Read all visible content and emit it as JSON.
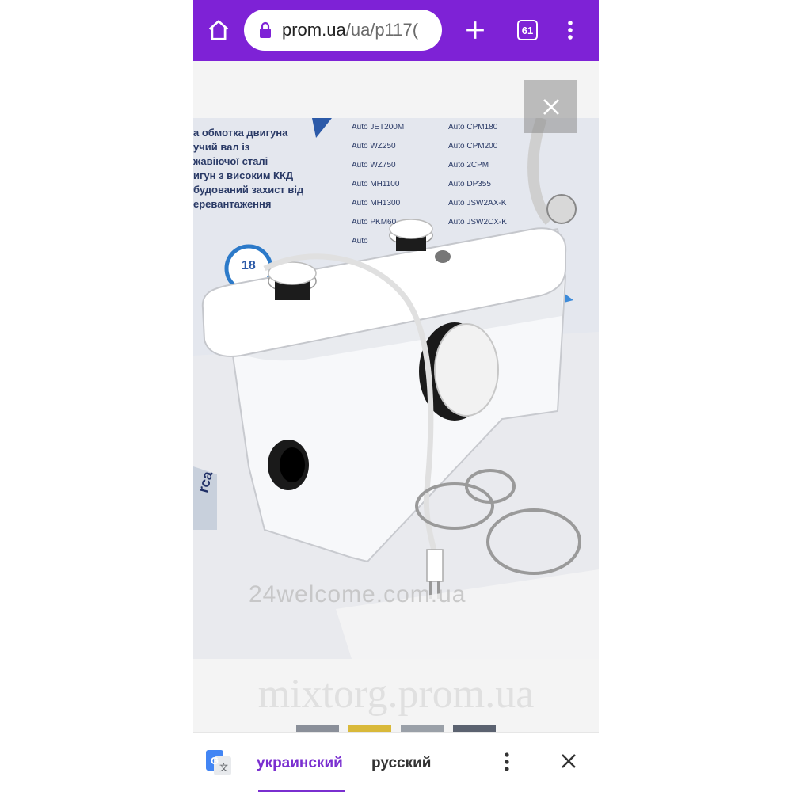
{
  "browser": {
    "url_host": "prom.ua",
    "url_path": "/ua/p117(",
    "tab_count": "61",
    "accent_color": "#7e22d6"
  },
  "photo": {
    "box_features": [
      "а обмотка двигуна",
      "учий вал із",
      "жавіючої сталі",
      "игун з високим ККД",
      "будований захист від",
      "еревантаження"
    ],
    "box_models_left": [
      "Auto JET200M",
      "Auto WZ250",
      "Auto WZ750",
      "Auto MH1100",
      "Auto MH1300",
      "Auto PKM60",
      "Auto"
    ],
    "box_models_right": [
      "Auto CPM180",
      "Auto CPM200",
      "Auto 2CPM",
      "Auto DP355",
      "Auto JSW2AX-K",
      "Auto JSW2CX-K"
    ],
    "badge_number": "18",
    "brand_fragment": "rca",
    "watermark_inner": "24welcome.com.ua",
    "watermark_outer": "mixtorg.prom.ua"
  },
  "translate": {
    "lang_selected": "украинский",
    "lang_other": "русский"
  }
}
